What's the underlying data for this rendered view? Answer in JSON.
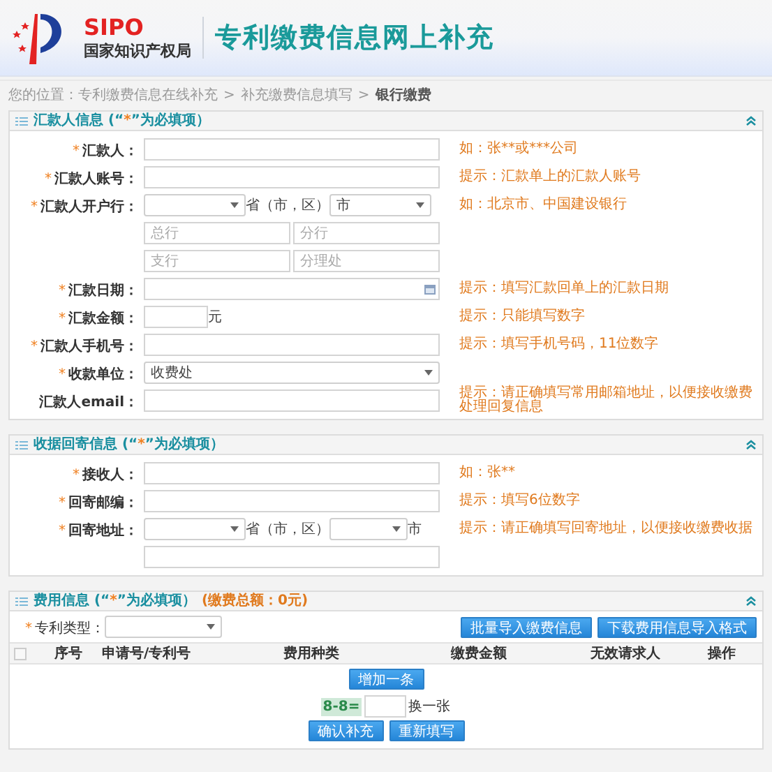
{
  "header": {
    "logo_text": "SIPO",
    "logo_subtitle": "国家知识产权局",
    "title": "专利缴费信息网上补充"
  },
  "breadcrumb": {
    "prefix": "您的位置：",
    "separator": ">",
    "items": [
      {
        "label": "专利缴费信息在线补充",
        "current": false
      },
      {
        "label": "补充缴费信息填写",
        "current": false
      },
      {
        "label": "银行缴费",
        "current": true
      }
    ]
  },
  "required_mark": "*",
  "sections": [
    {
      "title": "汇款人信息 (“",
      "title_end": "”为必填项）",
      "expanded": true,
      "rows": [
        {
          "kind": "input",
          "label": "汇款人：",
          "required": true,
          "hint": "如：张**或***公司"
        },
        {
          "kind": "input",
          "label": "汇款人账号：",
          "required": true,
          "hint": "提示：汇款单上的汇款人账号"
        },
        {
          "kind": "region",
          "label": "汇款人开户行：",
          "required": true,
          "between": "省（市，区）",
          "second_value": "市",
          "hint": "如：北京市、中国建设银行"
        },
        {
          "kind": "pair",
          "placeholders": [
            "总行",
            "分行"
          ]
        },
        {
          "kind": "pair",
          "placeholders": [
            "支行",
            "分理处"
          ]
        },
        {
          "kind": "date",
          "label": "汇款日期：",
          "required": true,
          "hint": "提示：填写汇款回单上的汇款日期"
        },
        {
          "kind": "amount",
          "label": "汇款金额：",
          "required": true,
          "unit": "元",
          "hint": "提示：只能填写数字"
        },
        {
          "kind": "input",
          "label": "汇款人手机号：",
          "required": true,
          "hint": "提示：填写手机号码，11位数字"
        },
        {
          "kind": "select",
          "label": "收款单位：",
          "required": true,
          "value": "收费处"
        },
        {
          "kind": "input",
          "label": "汇款人email：",
          "required": false,
          "hint": "提示：请正确填写常用邮箱地址，以便接收缴费处理回复信息"
        }
      ]
    },
    {
      "title": "收据回寄信息 (“",
      "title_end": "”为必填项）",
      "expanded": true,
      "rows": [
        {
          "kind": "input",
          "label": "接收人：",
          "required": true,
          "hint": "如：张**"
        },
        {
          "kind": "input",
          "label": "回寄邮编：",
          "required": true,
          "hint": "提示：填写6位数字"
        },
        {
          "kind": "region",
          "label": "回寄地址：",
          "required": true,
          "between": "省（市，区）",
          "after": "市",
          "hint": "提示：请正确填写回寄地址，以便接收缴费收据"
        },
        {
          "kind": "line"
        }
      ]
    }
  ],
  "fees": {
    "title": "费用信息 (“",
    "title_end": "”为必填项）",
    "total": "(缴费总额：0元)",
    "expanded": true,
    "type_label": "专利类型：",
    "type_required": true,
    "buttons": [
      "批量导入缴费信息",
      "下载费用信息导入格式"
    ],
    "select_all_checked": false,
    "columns": [
      "序号",
      "申请号/专利号",
      "费用种类",
      "缴费金额",
      "无效请求人",
      "操作"
    ],
    "add_button": "增加一条",
    "captcha": "8-8=",
    "refresh": "换一张",
    "actions": [
      "确认补充",
      "重新填写"
    ]
  }
}
